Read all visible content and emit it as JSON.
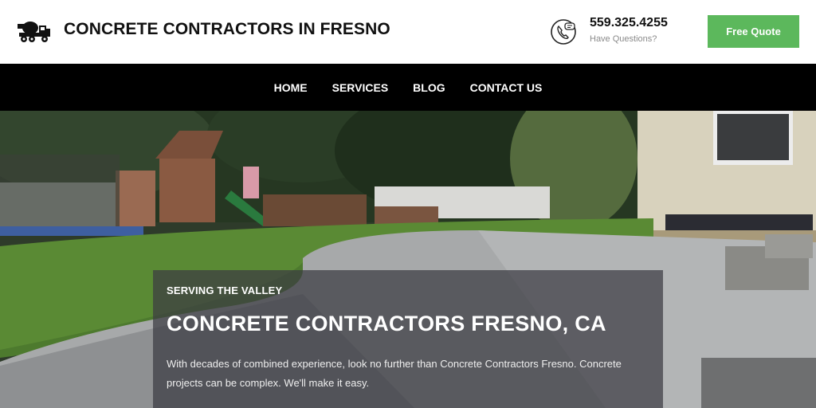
{
  "header": {
    "site_title": "CONCRETE CONTRACTORS IN FRESNO",
    "logo_icon": "concrete-mixer-truck-icon",
    "phone_icon": "phone-chat-icon",
    "phone_number": "559.325.4255",
    "phone_sub": "Have Questions?",
    "quote_button": "Free Quote"
  },
  "nav": {
    "items": [
      {
        "label": "HOME"
      },
      {
        "label": "SERVICES"
      },
      {
        "label": "BLOG"
      },
      {
        "label": "CONTACT US"
      }
    ]
  },
  "hero": {
    "eyebrow": "SERVING THE VALLEY",
    "title": "CONCRETE CONTRACTORS FRESNO, CA",
    "text": "With decades of combined experience, look no further than Concrete Contractors Fresno. Concrete projects can be complex. We'll make it easy."
  },
  "colors": {
    "accent": "#5cb85c",
    "nav_bg": "#000000",
    "overlay": "#3c3c42"
  }
}
